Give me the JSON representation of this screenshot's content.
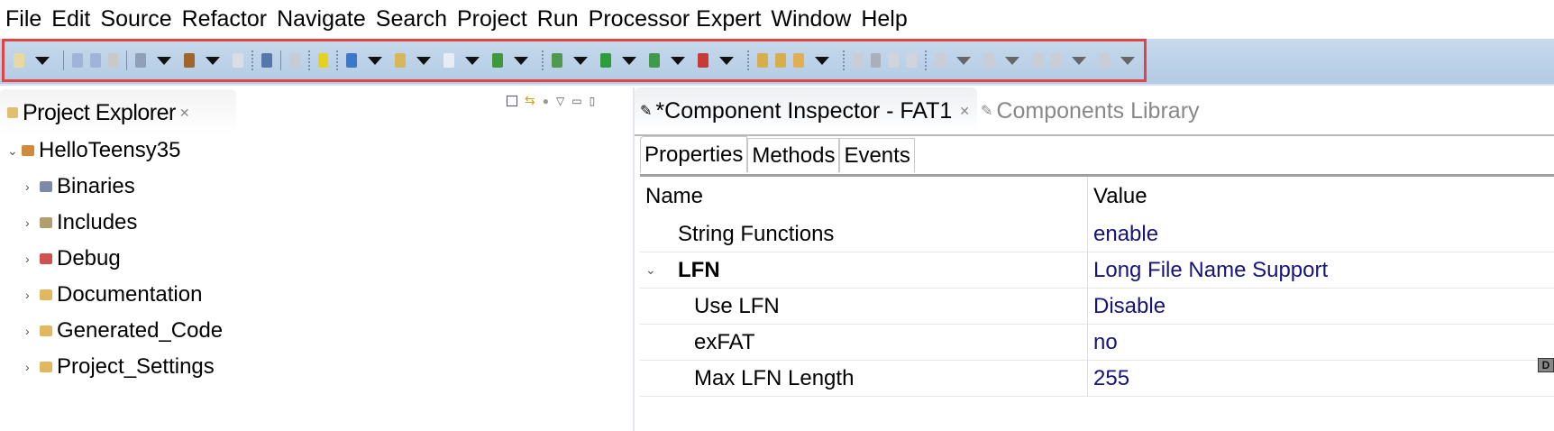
{
  "menu": [
    "File",
    "Edit",
    "Source",
    "Refactor",
    "Navigate",
    "Search",
    "Project",
    "Run",
    "Processor Expert",
    "Window",
    "Help"
  ],
  "toolbar": [
    {
      "icon": "new-icon",
      "color": "#e8d9a0",
      "dd": true
    },
    {
      "sep": "bar"
    },
    {
      "icon": "save-icon",
      "color": "#9fb4d6"
    },
    {
      "icon": "save-all-icon",
      "color": "#9fb4d6"
    },
    {
      "icon": "print-icon",
      "color": "#c9c9c9"
    },
    {
      "sep": "bar"
    },
    {
      "icon": "build-config-icon",
      "color": "#8fa0b8",
      "dd": true
    },
    {
      "icon": "hammer-build-icon",
      "color": "#a0652a",
      "dd": true
    },
    {
      "icon": "binary-icon",
      "color": "#d9dee6"
    },
    {
      "sep": "dots"
    },
    {
      "icon": "skip-breakpoints-icon",
      "color": "#5577aa"
    },
    {
      "sep": "bar"
    },
    {
      "icon": "step-icon",
      "color": "#c5ccd6"
    },
    {
      "sep": "dots"
    },
    {
      "icon": "flash-icon",
      "color": "#e6d21a"
    },
    {
      "sep": "dots"
    },
    {
      "icon": "new-c-project-icon",
      "color": "#3c78c8",
      "dd": true
    },
    {
      "icon": "new-folder-icon",
      "color": "#d8b65a",
      "dd": true
    },
    {
      "icon": "new-c-file-icon",
      "color": "#e8ecf4",
      "dd": true
    },
    {
      "icon": "new-class-icon",
      "color": "#3c9a3c",
      "dd": true
    },
    {
      "sep": "dots"
    },
    {
      "icon": "debug-icon",
      "color": "#4f9a4f",
      "dd": true
    },
    {
      "icon": "run-icon",
      "color": "#2f9c3a",
      "dd": true
    },
    {
      "icon": "run-config-icon",
      "color": "#3f9a4a",
      "dd": true
    },
    {
      "icon": "external-tools-icon",
      "color": "#c83a3a",
      "dd": true
    },
    {
      "sep": "dots"
    },
    {
      "icon": "open-type-icon",
      "color": "#d6ae4a"
    },
    {
      "icon": "open-folder-icon",
      "color": "#d6ae4a"
    },
    {
      "icon": "search-icon",
      "color": "#e0b050",
      "dd": true
    },
    {
      "sep": "dots"
    },
    {
      "icon": "edit-disabled-icon",
      "color": "#c8cdd6"
    },
    {
      "icon": "mark-occurrences-icon",
      "color": "#aab0ba"
    },
    {
      "icon": "block-selection-icon",
      "color": "#d0d5dd"
    },
    {
      "icon": "show-whitespace-icon",
      "color": "#d0d5dd"
    },
    {
      "sep": "dots"
    },
    {
      "icon": "next-annotation-icon",
      "color": "#c8cdd6",
      "dd": true,
      "dis": true
    },
    {
      "icon": "prev-annotation-icon",
      "color": "#c8cdd6",
      "dd": true,
      "dis": true
    },
    {
      "icon": "last-edit-icon",
      "color": "#c8cdd6"
    },
    {
      "icon": "back-icon",
      "color": "#c8cdd6",
      "dd": true,
      "dis": true
    },
    {
      "icon": "forward-icon",
      "color": "#c8cdd6",
      "dd": true,
      "dis": true
    }
  ],
  "left": {
    "title": "Project Explorer",
    "tree": [
      {
        "label": "HelloTeensy35",
        "expanded": true,
        "level": 0,
        "color": "#d08a3a"
      },
      {
        "label": "Binaries",
        "level": 1,
        "color": "#7a8aa8"
      },
      {
        "label": "Includes",
        "level": 1,
        "color": "#b0a070"
      },
      {
        "label": "Debug",
        "level": 1,
        "color": "#d25050"
      },
      {
        "label": "Documentation",
        "level": 1,
        "color": "#e0b860"
      },
      {
        "label": "Generated_Code",
        "level": 1,
        "color": "#e0b860"
      },
      {
        "label": "Project_Settings",
        "level": 1,
        "color": "#e0b860"
      }
    ]
  },
  "right": {
    "active_tab": "*Component Inspector - FAT1",
    "other_tab": "Components Library",
    "subtabs": [
      "Properties",
      "Methods",
      "Events"
    ],
    "columns": [
      "Name",
      "Value"
    ],
    "rows": [
      {
        "name": "String Functions",
        "value": "enable",
        "indent": 1
      },
      {
        "name": "LFN",
        "value": "Long File Name Support",
        "indent": 1,
        "bold": true,
        "expanded": true
      },
      {
        "name": "Use LFN",
        "value": "Disable",
        "indent": 2
      },
      {
        "name": "exFAT",
        "value": "no",
        "indent": 2
      },
      {
        "name": "Max LFN Length",
        "value": "255",
        "indent": 2
      }
    ]
  },
  "badge": "D"
}
